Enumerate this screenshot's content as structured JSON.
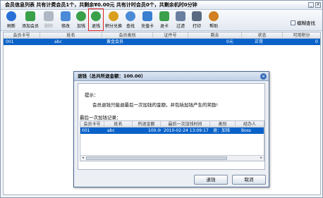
{
  "window": {
    "title": "会员信息列表   共有计费会员1个，共剩余¥0.00元   共有计时会员0个，共剩余机时0分钟"
  },
  "toolbar": {
    "items": [
      {
        "label": "刷新",
        "icon": "refresh-icon",
        "color": "#2a6fd6"
      },
      {
        "label": "添加会员",
        "icon": "add-member-icon",
        "color": "#3aa04a"
      },
      {
        "label": "删除",
        "icon": "delete-member-icon",
        "color": "#9aa4b0"
      },
      {
        "label": "修改",
        "icon": "edit-icon",
        "color": "#4a8ad6"
      },
      {
        "label": "加钱",
        "icon": "add-money-icon",
        "color": "#3aa04a"
      },
      {
        "label": "退钱",
        "icon": "refund-icon",
        "color": "#3aa04a"
      },
      {
        "label": "积分兑换",
        "icon": "points-exchange-icon",
        "color": "#d9a020"
      },
      {
        "label": "查找",
        "icon": "search-icon",
        "color": "#4a8ad6"
      },
      {
        "label": "充值卡",
        "icon": "recharge-card-icon",
        "color": "#3a7fd0"
      },
      {
        "label": "退卡",
        "icon": "return-card-icon",
        "color": "#3aa04a"
      },
      {
        "label": "过滤",
        "icon": "filter-icon",
        "color": "#6a7fa0"
      },
      {
        "label": "打印",
        "icon": "printer-icon",
        "color": "#5a6a80"
      },
      {
        "label": "帮助",
        "icon": "help-icon",
        "color": "#d08020"
      }
    ],
    "fuzzy_search_label": "模糊查找"
  },
  "grid": {
    "columns": [
      "会员卡号",
      "姓名",
      "会员类别",
      "证件号",
      "剩余",
      "状态",
      "可用积分"
    ],
    "rows": [
      [
        "001",
        "abc",
        "黄金会员",
        "",
        "0元",
        "正常",
        "0"
      ]
    ]
  },
  "dialog": {
    "title": "退钱（总共所退金额：100.00）",
    "hint_label": "提示：",
    "hint_text": "会员退钱只能退最后一次加钱的金额，并包括加钱产生的奖励!",
    "records_label": "最后一次加钱记录：",
    "columns": [
      "会员卡号",
      "姓名",
      "所退金额",
      "最后一次加钱时间",
      "类别",
      "经办人"
    ],
    "rows": [
      [
        "001",
        "abc",
        "100.00",
        "2010-02-24 13:09:17",
        "退：加钱",
        "Boss"
      ]
    ],
    "confirm_label": "退钱",
    "cancel_label": "取消"
  }
}
